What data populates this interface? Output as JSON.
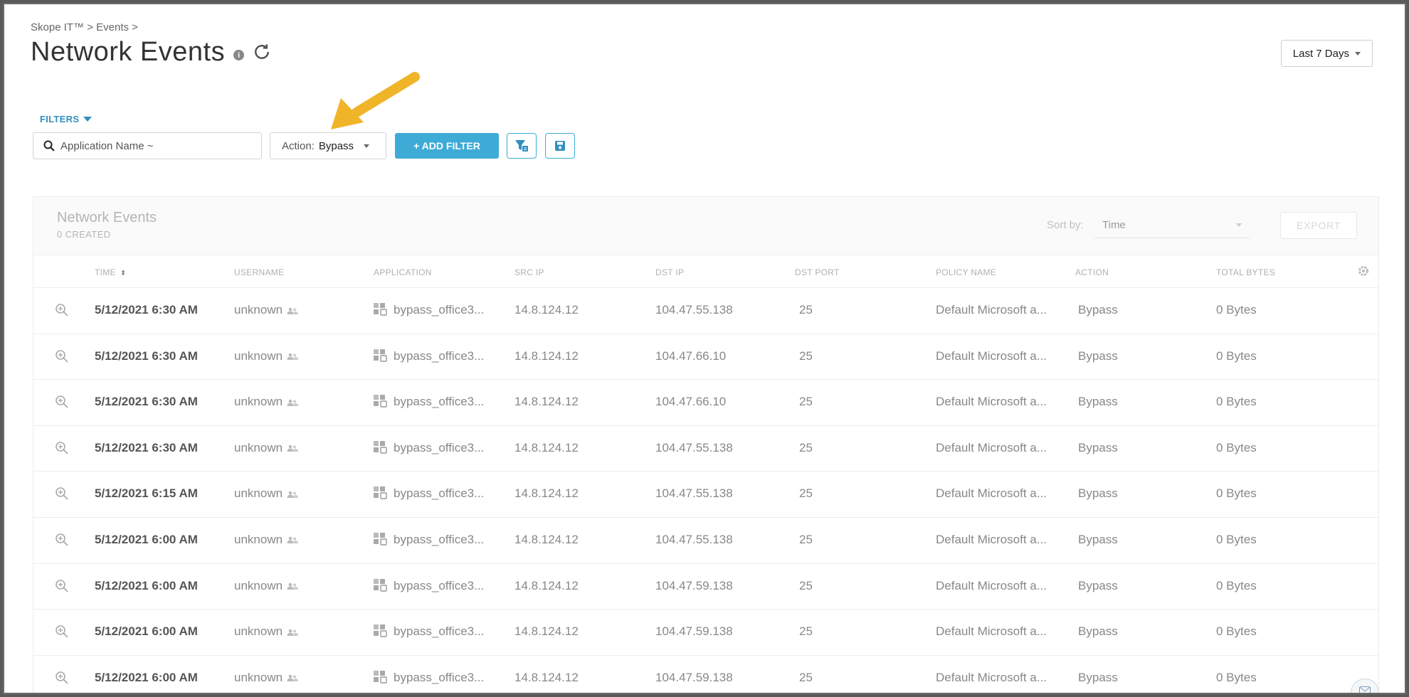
{
  "breadcrumb": "Skope IT™ > Events >",
  "page_title": "Network Events",
  "info_icon_glyph": "i",
  "date_range": "Last 7 Days",
  "filters": {
    "label": "FILTERS",
    "search_placeholder": "Application Name ~",
    "action_prefix": "Action:",
    "action_value": "Bypass",
    "add_filter_label": "+ ADD FILTER"
  },
  "panel": {
    "title": "Network Events",
    "subtitle": "0 CREATED",
    "sort_label": "Sort by:",
    "sort_value": "Time",
    "export_label": "EXPORT"
  },
  "table": {
    "headers": [
      "TIME",
      "USERNAME",
      "APPLICATION",
      "SRC IP",
      "DST IP",
      "DST PORT",
      "POLICY NAME",
      "ACTION",
      "TOTAL BYTES"
    ],
    "rows": [
      {
        "time": "5/12/2021 6:30 AM",
        "username": "unknown",
        "application": "bypass_office3...",
        "src_ip": "14.8.124.12",
        "dst_ip": "104.47.55.138",
        "dst_port": "25",
        "policy": "Default Microsoft a...",
        "action": "Bypass",
        "bytes": "0 Bytes"
      },
      {
        "time": "5/12/2021 6:30 AM",
        "username": "unknown",
        "application": "bypass_office3...",
        "src_ip": "14.8.124.12",
        "dst_ip": "104.47.66.10",
        "dst_port": "25",
        "policy": "Default Microsoft a...",
        "action": "Bypass",
        "bytes": "0 Bytes"
      },
      {
        "time": "5/12/2021 6:30 AM",
        "username": "unknown",
        "application": "bypass_office3...",
        "src_ip": "14.8.124.12",
        "dst_ip": "104.47.66.10",
        "dst_port": "25",
        "policy": "Default Microsoft a...",
        "action": "Bypass",
        "bytes": "0 Bytes"
      },
      {
        "time": "5/12/2021 6:30 AM",
        "username": "unknown",
        "application": "bypass_office3...",
        "src_ip": "14.8.124.12",
        "dst_ip": "104.47.55.138",
        "dst_port": "25",
        "policy": "Default Microsoft a...",
        "action": "Bypass",
        "bytes": "0 Bytes"
      },
      {
        "time": "5/12/2021 6:15 AM",
        "username": "unknown",
        "application": "bypass_office3...",
        "src_ip": "14.8.124.12",
        "dst_ip": "104.47.55.138",
        "dst_port": "25",
        "policy": "Default Microsoft a...",
        "action": "Bypass",
        "bytes": "0 Bytes"
      },
      {
        "time": "5/12/2021 6:00 AM",
        "username": "unknown",
        "application": "bypass_office3...",
        "src_ip": "14.8.124.12",
        "dst_ip": "104.47.55.138",
        "dst_port": "25",
        "policy": "Default Microsoft a...",
        "action": "Bypass",
        "bytes": "0 Bytes"
      },
      {
        "time": "5/12/2021 6:00 AM",
        "username": "unknown",
        "application": "bypass_office3...",
        "src_ip": "14.8.124.12",
        "dst_ip": "104.47.59.138",
        "dst_port": "25",
        "policy": "Default Microsoft a...",
        "action": "Bypass",
        "bytes": "0 Bytes"
      },
      {
        "time": "5/12/2021 6:00 AM",
        "username": "unknown",
        "application": "bypass_office3...",
        "src_ip": "14.8.124.12",
        "dst_ip": "104.47.59.138",
        "dst_port": "25",
        "policy": "Default Microsoft a...",
        "action": "Bypass",
        "bytes": "0 Bytes"
      },
      {
        "time": "5/12/2021 6:00 AM",
        "username": "unknown",
        "application": "bypass_office3...",
        "src_ip": "14.8.124.12",
        "dst_ip": "104.47.59.138",
        "dst_port": "25",
        "policy": "Default Microsoft a...",
        "action": "Bypass",
        "bytes": "0 Bytes"
      }
    ]
  },
  "icons": {
    "search": "search-icon",
    "refresh": "refresh-icon",
    "info": "info-icon",
    "filter_settings": "filter-settings-icon",
    "save": "save-icon",
    "zoom": "zoom-in-icon",
    "user": "users-icon",
    "app": "application-icon",
    "gear": "gear-icon",
    "chat": "chat-icon",
    "annotation_arrow": "annotation-arrow-icon"
  },
  "colors": {
    "accent": "#3eabd7",
    "filters_label": "#2f8fc0",
    "annotation_arrow": "#f0b429"
  }
}
